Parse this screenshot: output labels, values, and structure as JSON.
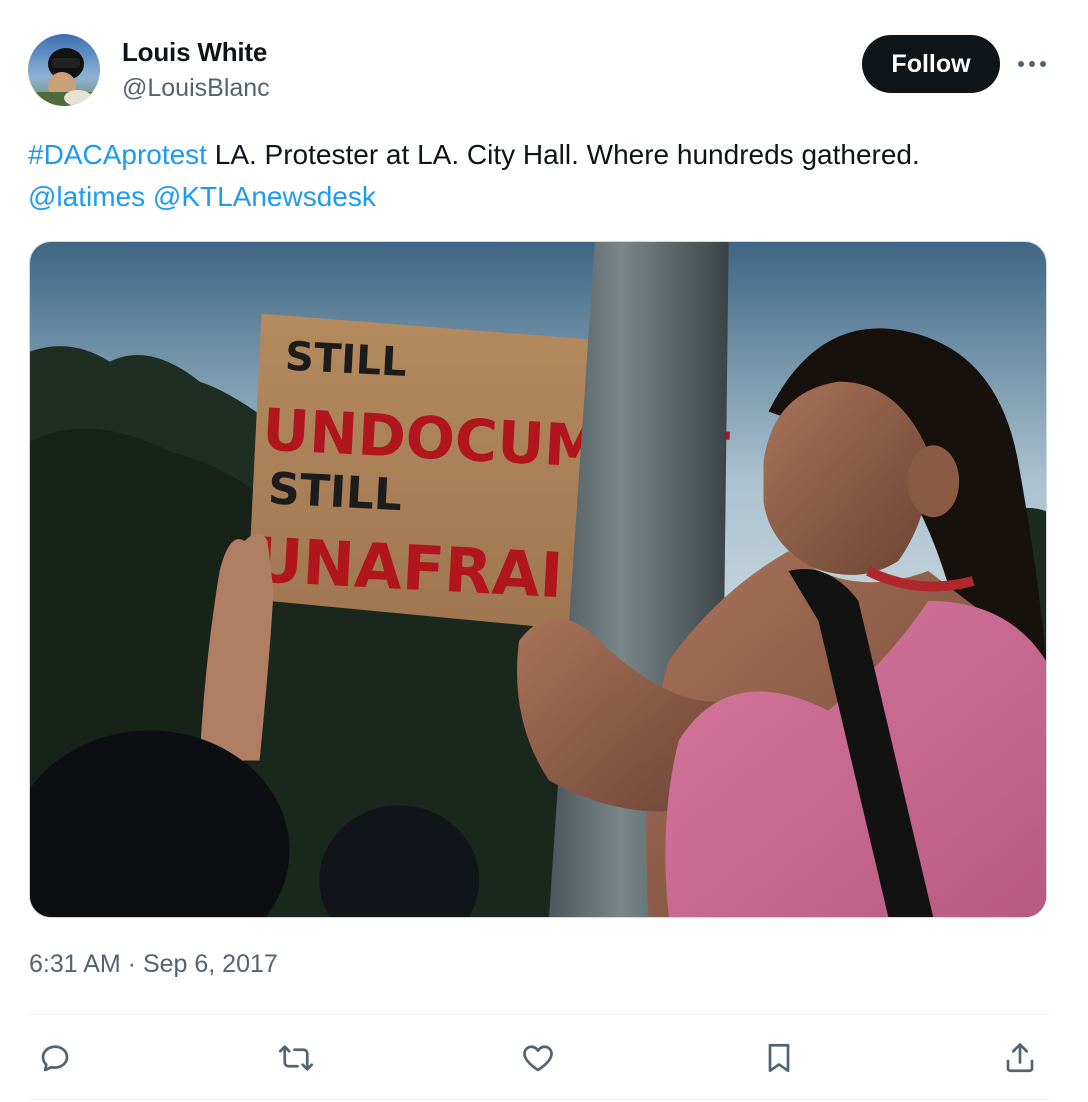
{
  "author": {
    "display_name": "Louis White",
    "handle": "@LouisBlanc",
    "avatar_icon": "profile-photo"
  },
  "header": {
    "follow_label": "Follow",
    "more_icon": "more-horizontal-icon"
  },
  "tweet": {
    "hashtag": "#DACAprotest",
    "text": " LA. Protester at LA. City Hall. Where hundreds gathered.",
    "mention_1": "@latimes",
    "mention_2": "@KTLAnewsdesk",
    "timestamp": "6:31 AM · Sep 6, 2017"
  },
  "media": {
    "sign_lines": [
      "STILL",
      "UNDOCUMENT",
      "STILL",
      "UNAFRAI"
    ]
  },
  "actions": [
    {
      "name": "reply",
      "icon": "reply-icon"
    },
    {
      "name": "repost",
      "icon": "repost-icon"
    },
    {
      "name": "like",
      "icon": "heart-icon"
    },
    {
      "name": "bookmark",
      "icon": "bookmark-icon"
    },
    {
      "name": "share",
      "icon": "share-icon"
    }
  ],
  "colors": {
    "link": "#1d9bf0",
    "text": "#0f1419",
    "secondary": "#536471",
    "follow_bg": "#0f1419"
  }
}
